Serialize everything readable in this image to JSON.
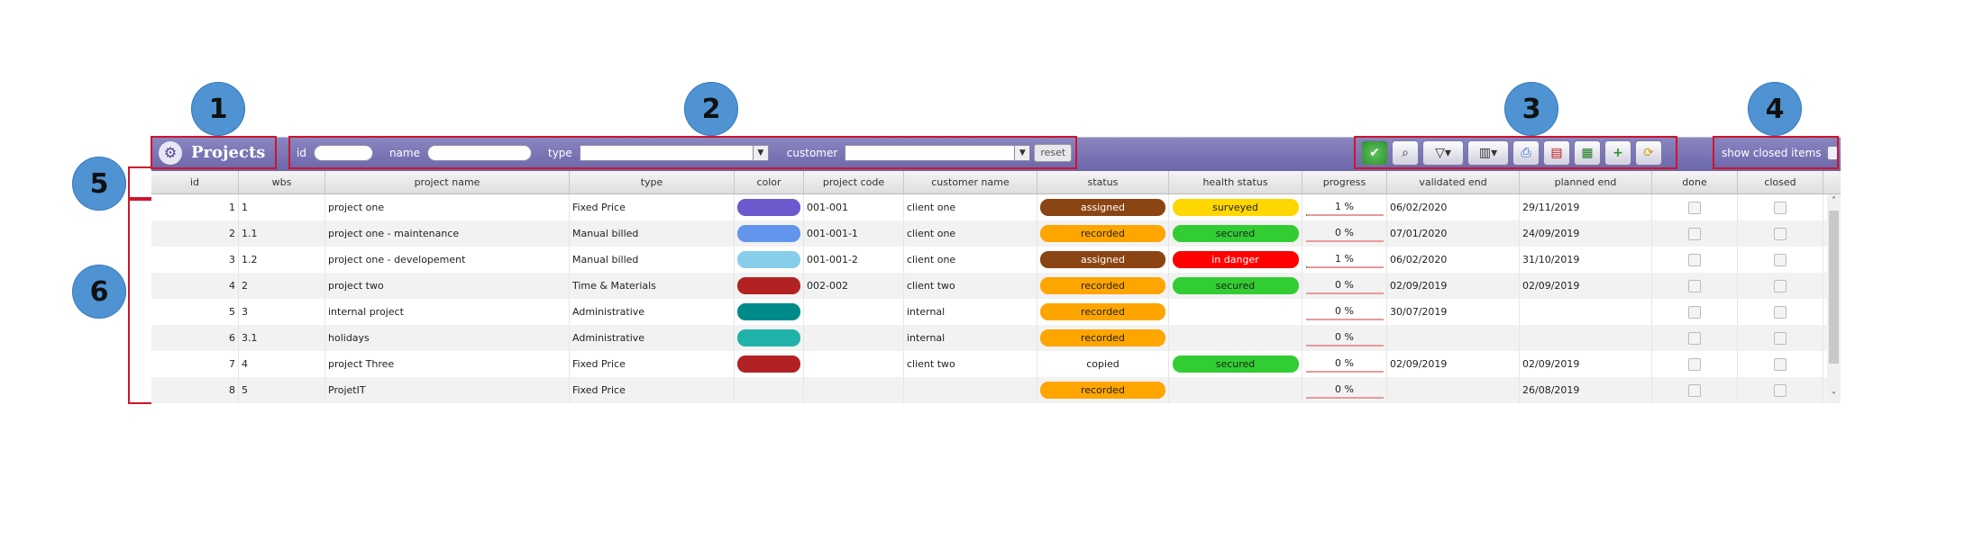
{
  "callouts": [
    "1",
    "2",
    "3",
    "4",
    "5",
    "6"
  ],
  "app": {
    "title": "Projects",
    "logo_icon": "gear-logo-icon"
  },
  "filters": {
    "id_label": "id",
    "id_value": "",
    "name_label": "name",
    "name_value": "",
    "type_label": "type",
    "type_value": "",
    "customer_label": "customer",
    "customer_value": "",
    "reset_label": "reset"
  },
  "actions": [
    {
      "name": "validate-icon",
      "glyph": "✔"
    },
    {
      "name": "search-icon",
      "glyph": "⌕"
    },
    {
      "name": "filter-icon",
      "glyph": "▽▾"
    },
    {
      "name": "columns-icon",
      "glyph": "▥▾"
    },
    {
      "name": "print-icon",
      "glyph": "⎙"
    },
    {
      "name": "pdf-icon",
      "glyph": "▤"
    },
    {
      "name": "excel-icon",
      "glyph": "▦"
    },
    {
      "name": "add-icon",
      "glyph": "+"
    },
    {
      "name": "refresh-icon",
      "glyph": "⟳"
    }
  ],
  "show_closed": {
    "label": "show closed items",
    "checked": false
  },
  "columns": [
    "id",
    "wbs",
    "project name",
    "type",
    "color",
    "project code",
    "customer name",
    "status",
    "health status",
    "progress",
    "validated end",
    "planned end",
    "done",
    "closed"
  ],
  "rows": [
    {
      "id": "1",
      "wbs": "1",
      "name": "project one",
      "type": "Fixed Price",
      "color": "#6a5acd",
      "code": "001-001",
      "customer": "client one",
      "status": "assigned",
      "status_color": "#8b4513",
      "status_text_color": "#ffffff",
      "health": "surveyed",
      "health_color": "#ffd700",
      "health_text_color": "#222222",
      "progress": "1 %",
      "progress_value": 1,
      "validated_end": "06/02/2020",
      "planned_end": "29/11/2019"
    },
    {
      "id": "2",
      "wbs": "1.1",
      "name": "project one - maintenance",
      "type": "Manual billed",
      "color": "#6495ed",
      "code": "001-001-1",
      "customer": "client one",
      "status": "recorded",
      "status_color": "#ffa500",
      "status_text_color": "#222222",
      "health": "secured",
      "health_color": "#32cd32",
      "health_text_color": "#222222",
      "progress": "0 %",
      "progress_value": 0,
      "validated_end": "07/01/2020",
      "planned_end": "24/09/2019"
    },
    {
      "id": "3",
      "wbs": "1.2",
      "name": "project one - developement",
      "type": "Manual billed",
      "color": "#87ceeb",
      "code": "001-001-2",
      "customer": "client one",
      "status": "assigned",
      "status_color": "#8b4513",
      "status_text_color": "#ffffff",
      "health": "in danger",
      "health_color": "#ff0000",
      "health_text_color": "#ffffff",
      "progress": "1 %",
      "progress_value": 1,
      "validated_end": "06/02/2020",
      "planned_end": "31/10/2019"
    },
    {
      "id": "4",
      "wbs": "2",
      "name": "project two",
      "type": "Time & Materials",
      "color": "#b22222",
      "code": "002-002",
      "customer": "client two",
      "status": "recorded",
      "status_color": "#ffa500",
      "status_text_color": "#222222",
      "health": "secured",
      "health_color": "#32cd32",
      "health_text_color": "#222222",
      "progress": "0 %",
      "progress_value": 0,
      "validated_end": "02/09/2019",
      "planned_end": "02/09/2019"
    },
    {
      "id": "5",
      "wbs": "3",
      "name": "internal project",
      "type": "Administrative",
      "color": "#008b8b",
      "code": "",
      "customer": "internal",
      "status": "recorded",
      "status_color": "#ffa500",
      "status_text_color": "#222222",
      "health": "",
      "health_color": "",
      "health_text_color": "",
      "progress": "0 %",
      "progress_value": 0,
      "validated_end": "30/07/2019",
      "planned_end": ""
    },
    {
      "id": "6",
      "wbs": "3.1",
      "name": "holidays",
      "type": "Administrative",
      "color": "#20b2aa",
      "code": "",
      "customer": "internal",
      "status": "recorded",
      "status_color": "#ffa500",
      "status_text_color": "#222222",
      "health": "",
      "health_color": "",
      "health_text_color": "",
      "progress": "0 %",
      "progress_value": 0,
      "validated_end": "",
      "planned_end": ""
    },
    {
      "id": "7",
      "wbs": "4",
      "name": "project Three",
      "type": "Fixed Price",
      "color": "#b22222",
      "code": "",
      "customer": "client two",
      "status": "copied",
      "status_color": "",
      "status_text_color": "#222222",
      "health": "secured",
      "health_color": "#32cd32",
      "health_text_color": "#222222",
      "progress": "0 %",
      "progress_value": 0,
      "validated_end": "02/09/2019",
      "planned_end": "02/09/2019"
    },
    {
      "id": "8",
      "wbs": "5",
      "name": "ProjetIT",
      "type": "Fixed Price",
      "color": "",
      "code": "",
      "customer": "",
      "status": "recorded",
      "status_color": "#ffa500",
      "status_text_color": "#222222",
      "health": "",
      "health_color": "",
      "health_text_color": "",
      "progress": "0 %",
      "progress_value": 0,
      "validated_end": "",
      "planned_end": "26/08/2019"
    }
  ],
  "scrollbar": {
    "up_glyph": "˄",
    "down_glyph": "˅"
  }
}
